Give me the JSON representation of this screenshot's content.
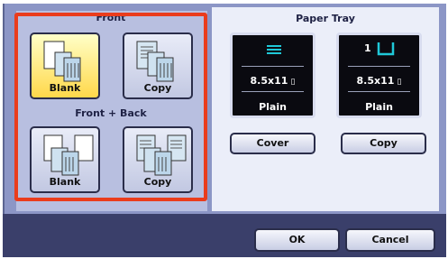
{
  "left": {
    "front_title": "Front",
    "front_back_title": "Front + Back",
    "front_options": [
      {
        "label": "Blank",
        "selected": true
      },
      {
        "label": "Copy",
        "selected": false
      }
    ],
    "front_back_options": [
      {
        "label": "Blank",
        "selected": false
      },
      {
        "label": "Copy",
        "selected": false
      }
    ]
  },
  "right": {
    "title": "Paper Tray",
    "trays": [
      {
        "number": "",
        "size": "8.5x11",
        "type": "Plain",
        "button": "Cover"
      },
      {
        "number": "1",
        "size": "8.5x11",
        "type": "Plain",
        "button": "Copy"
      }
    ]
  },
  "footer": {
    "ok_label": "OK",
    "cancel_label": "Cancel"
  },
  "colors": {
    "highlight": "#ea3c1c",
    "selected": "#ffd84a",
    "tray_indicator": "#1fc8d8"
  }
}
